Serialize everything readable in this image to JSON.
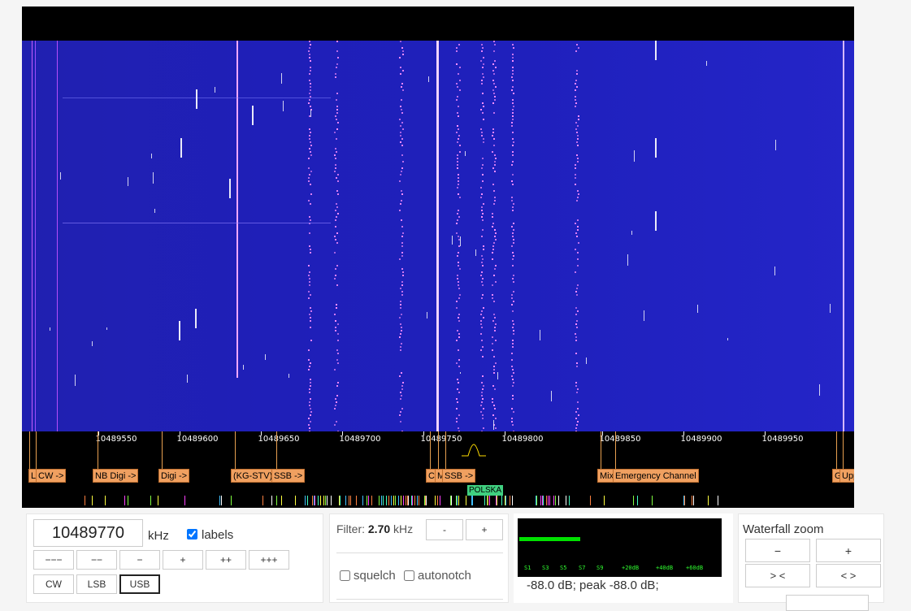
{
  "scale": {
    "ticks": [
      "10489550",
      "10489600",
      "10489650",
      "10489700",
      "10489750",
      "10489800",
      "10489850",
      "10489900",
      "10489950"
    ]
  },
  "bands": [
    {
      "label": "L"
    },
    {
      "label": "CW ->"
    },
    {
      "label": "NB Digi ->"
    },
    {
      "label": "Digi ->"
    },
    {
      "label": "(KG-STV)"
    },
    {
      "label": "SSB ->"
    },
    {
      "label": "C"
    },
    {
      "label": "M"
    },
    {
      "label": "SSB ->"
    },
    {
      "label": "Mix"
    },
    {
      "label": "Emergency Channel"
    },
    {
      "label": "G"
    },
    {
      "label": "Upper Beacon"
    }
  ],
  "spot_label": "POLSKA",
  "frequency": {
    "value": "10489770",
    "unit": "kHz",
    "labels_text": "labels",
    "labels_checked": true
  },
  "step_buttons": [
    "−−−",
    "−−",
    "−",
    "+",
    "++",
    "+++"
  ],
  "modes": [
    "CW",
    "LSB",
    "USB"
  ],
  "active_mode": "USB",
  "filter": {
    "prefix": "Filter:",
    "value": "2.70",
    "unit": "kHz",
    "minus": "-",
    "plus": "+",
    "squelch": "squelch",
    "autonotch": "autonotch"
  },
  "smeter": {
    "scale": [
      "S1",
      "S3",
      "S5",
      "S7",
      "S9",
      "+20dB",
      "+40dB",
      "+60dB"
    ],
    "level_fraction": 0.3,
    "readout": "-88.0 dB; peak   -88.0 dB;"
  },
  "waterfall_zoom": {
    "title": "Waterfall zoom",
    "zoom_out": "−",
    "zoom_in": "+",
    "narrow": "> <",
    "widen": "< >"
  },
  "colors": {
    "waterfall_bg": "#2020b8",
    "band_label": "#f0a060",
    "spot_label": "#40d080",
    "smeter_bar": "#00e000"
  }
}
